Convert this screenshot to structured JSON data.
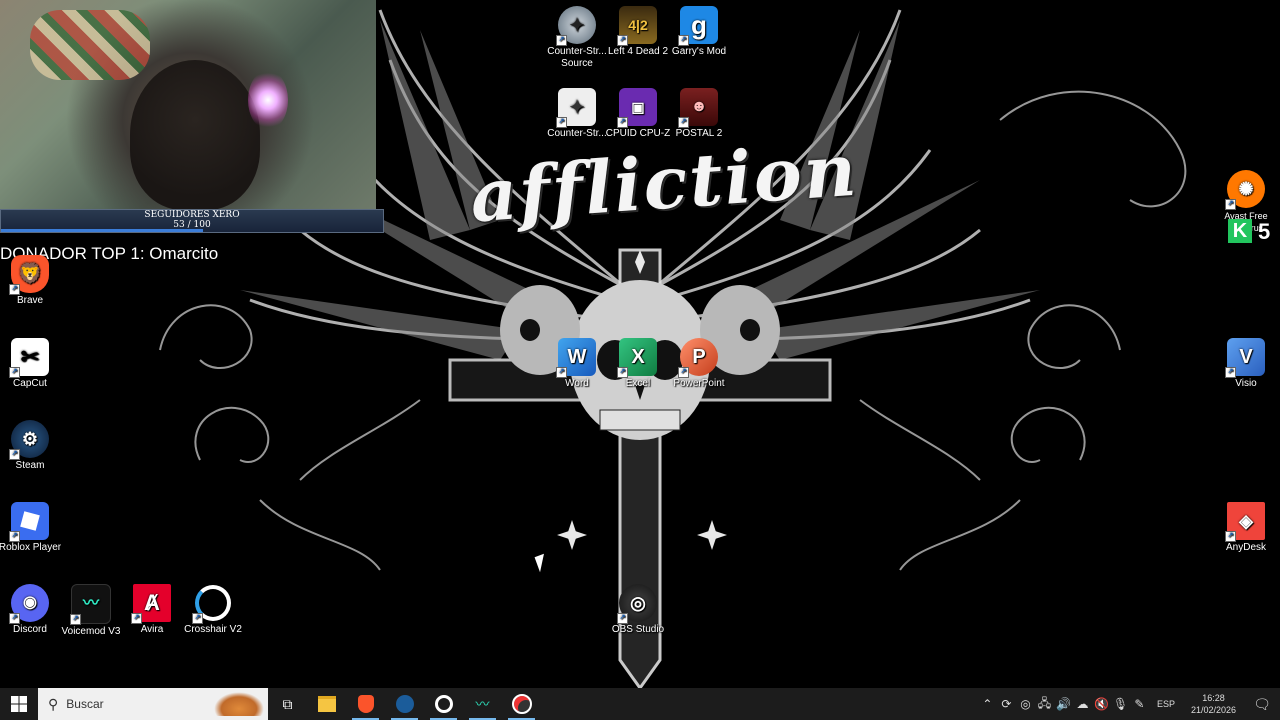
{
  "overlay": {
    "followers_title": "SEGUIDORES XERO",
    "followers_count": "53 / 100",
    "followers_progress": 0.53,
    "donor_text": "DONADOR TOP 1:  Omarcito"
  },
  "wallpaper": {
    "logo_text": "affliction"
  },
  "icons": {
    "css": "Counter-Str...\nSource",
    "l4d2": "Left 4 Dead 2",
    "gmod": "Garry's Mod",
    "cs": "Counter-Str...",
    "cpuz": "CPUID CPU-Z",
    "postal": "POSTAL 2",
    "brave": "Brave",
    "capcut": "CapCut",
    "steam": "Steam",
    "roblox": "Roblox Player",
    "discord": "Discord",
    "voicemod": "Voicemod V3",
    "avira": "Avira",
    "crosshair": "Crosshair V2",
    "word": "Word",
    "excel": "Excel",
    "powerpoint": "PowerPoint",
    "obs": "OBS Studio",
    "avast": "Avast Free Antivirus",
    "visio": "Visio",
    "anydesk": "AnyDesk",
    "k5_badge": "5"
  },
  "taskbar": {
    "search_placeholder": "Buscar",
    "language": "ESP",
    "time": "16:28",
    "date": "21/02/2026"
  },
  "colors": {
    "taskbar_bg": "#1c1c1c",
    "accent": "#76b9ed",
    "word": "#2b579a",
    "excel": "#217346",
    "powerpoint": "#d24726"
  }
}
